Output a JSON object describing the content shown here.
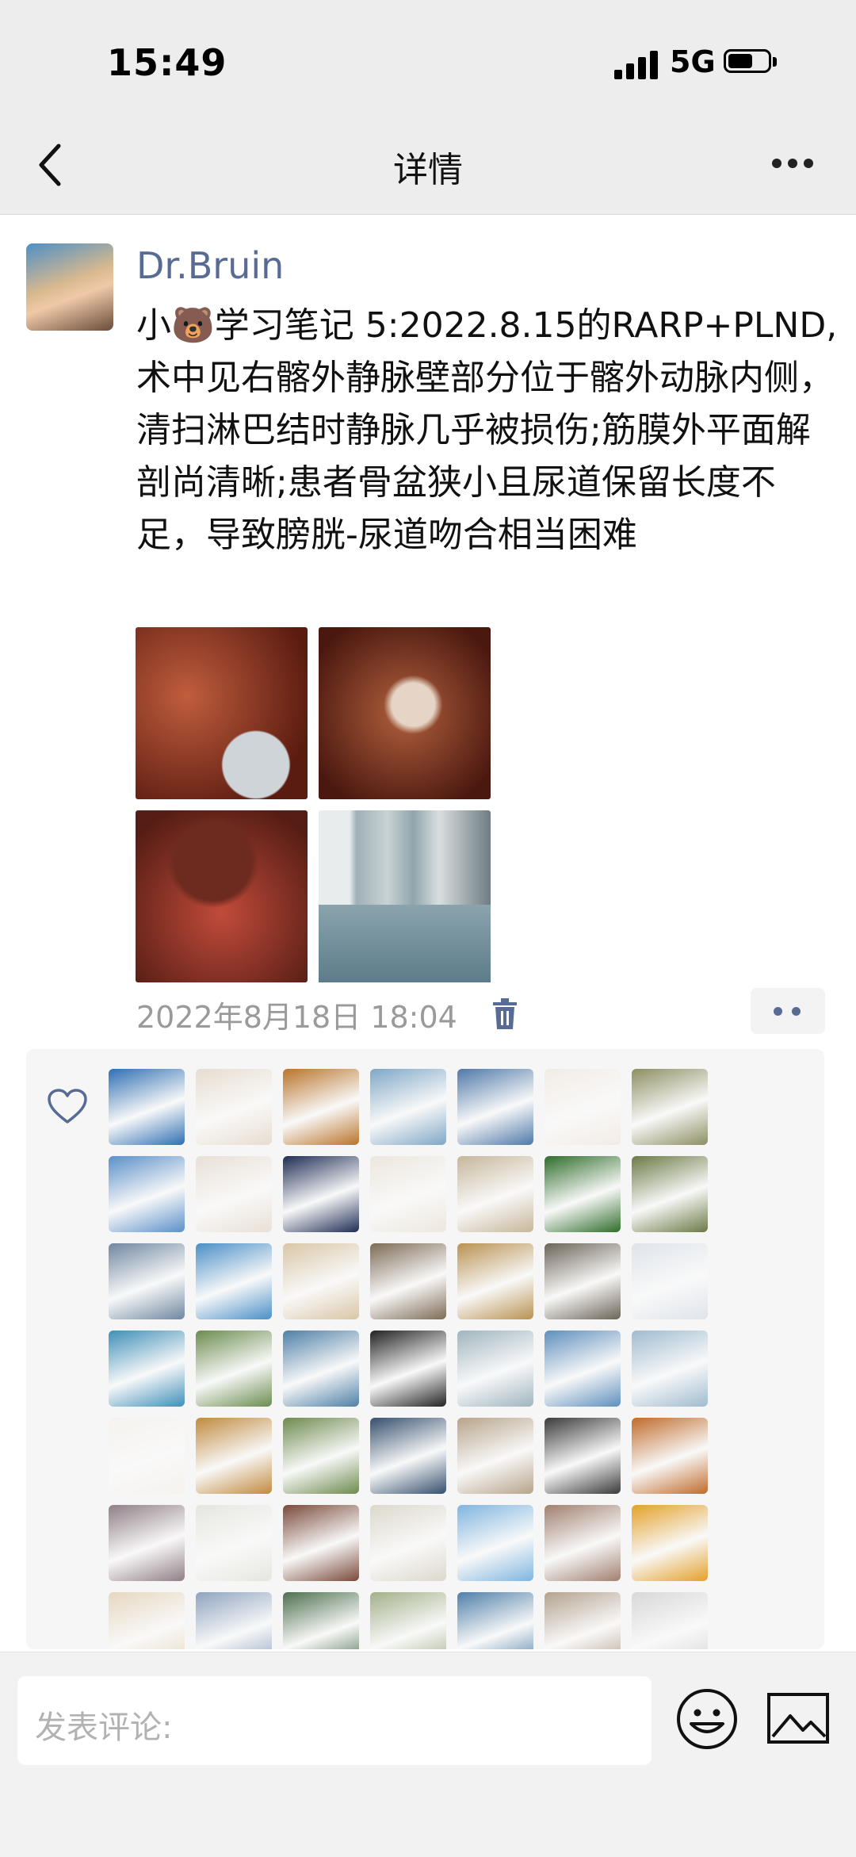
{
  "status_bar": {
    "time": "15:49",
    "network": "5G"
  },
  "header": {
    "title": "详情"
  },
  "post": {
    "author": "Dr.Bruin",
    "content": "小🐻学习笔记 5:2022.8.15的RARP+PLND,术中见右髂外静脉壁部分位于髂外动脉内侧，清扫淋巴结时静脉几乎被损伤;筋膜外平面解剖尚清晰;患者骨盆狭小且尿道保留长度不足，导致膀胱-尿道吻合相当困难",
    "timestamp": "2022年8月18日 18:04",
    "photos": [
      "surgery-photo",
      "surgery-photo",
      "surgery-photo",
      "hospital-corridor-photo"
    ]
  },
  "likes": {
    "avatar_colors": [
      [
        "#2f6fb3",
        "#e7ddd0",
        "#b9742a",
        "#7fa7c6",
        "#4f79a8",
        "#f2ece6",
        "#8c8f62"
      ],
      [
        "#5b8fc9",
        "#e8e0d6",
        "#1f2d55",
        "#ece7de",
        "#c7b69a",
        "#2f6d2b",
        "#6b7a45"
      ],
      [
        "#6f87a0",
        "#4a8fc7",
        "#d9c6a6",
        "#7d6b55",
        "#b99252",
        "#6b6458",
        "#dfe4ea"
      ],
      [
        "#3f8fb8",
        "#6b8c4f",
        "#4e7fa6",
        "#222222",
        "#9fb5bf",
        "#5f8fbd",
        "#9fbbd0"
      ],
      [
        "#f5f2ee",
        "#c08a3e",
        "#6d8a4e",
        "#35506e",
        "#b7a48a",
        "#3a3a3a",
        "#c06b2a"
      ],
      [
        "#8f7f86",
        "#e6e6e0",
        "#7a4a3a",
        "#dcd8cc",
        "#7fb5e0",
        "#a08070",
        "#e4a02a"
      ],
      [
        "#e6d8c0",
        "#8fa3bf",
        "#4d6f4e",
        "#a3b08a",
        "#4f7fa8",
        "#b4a28f",
        "#d8d8d8"
      ]
    ]
  },
  "comment_bar": {
    "placeholder": "发表评论:"
  }
}
